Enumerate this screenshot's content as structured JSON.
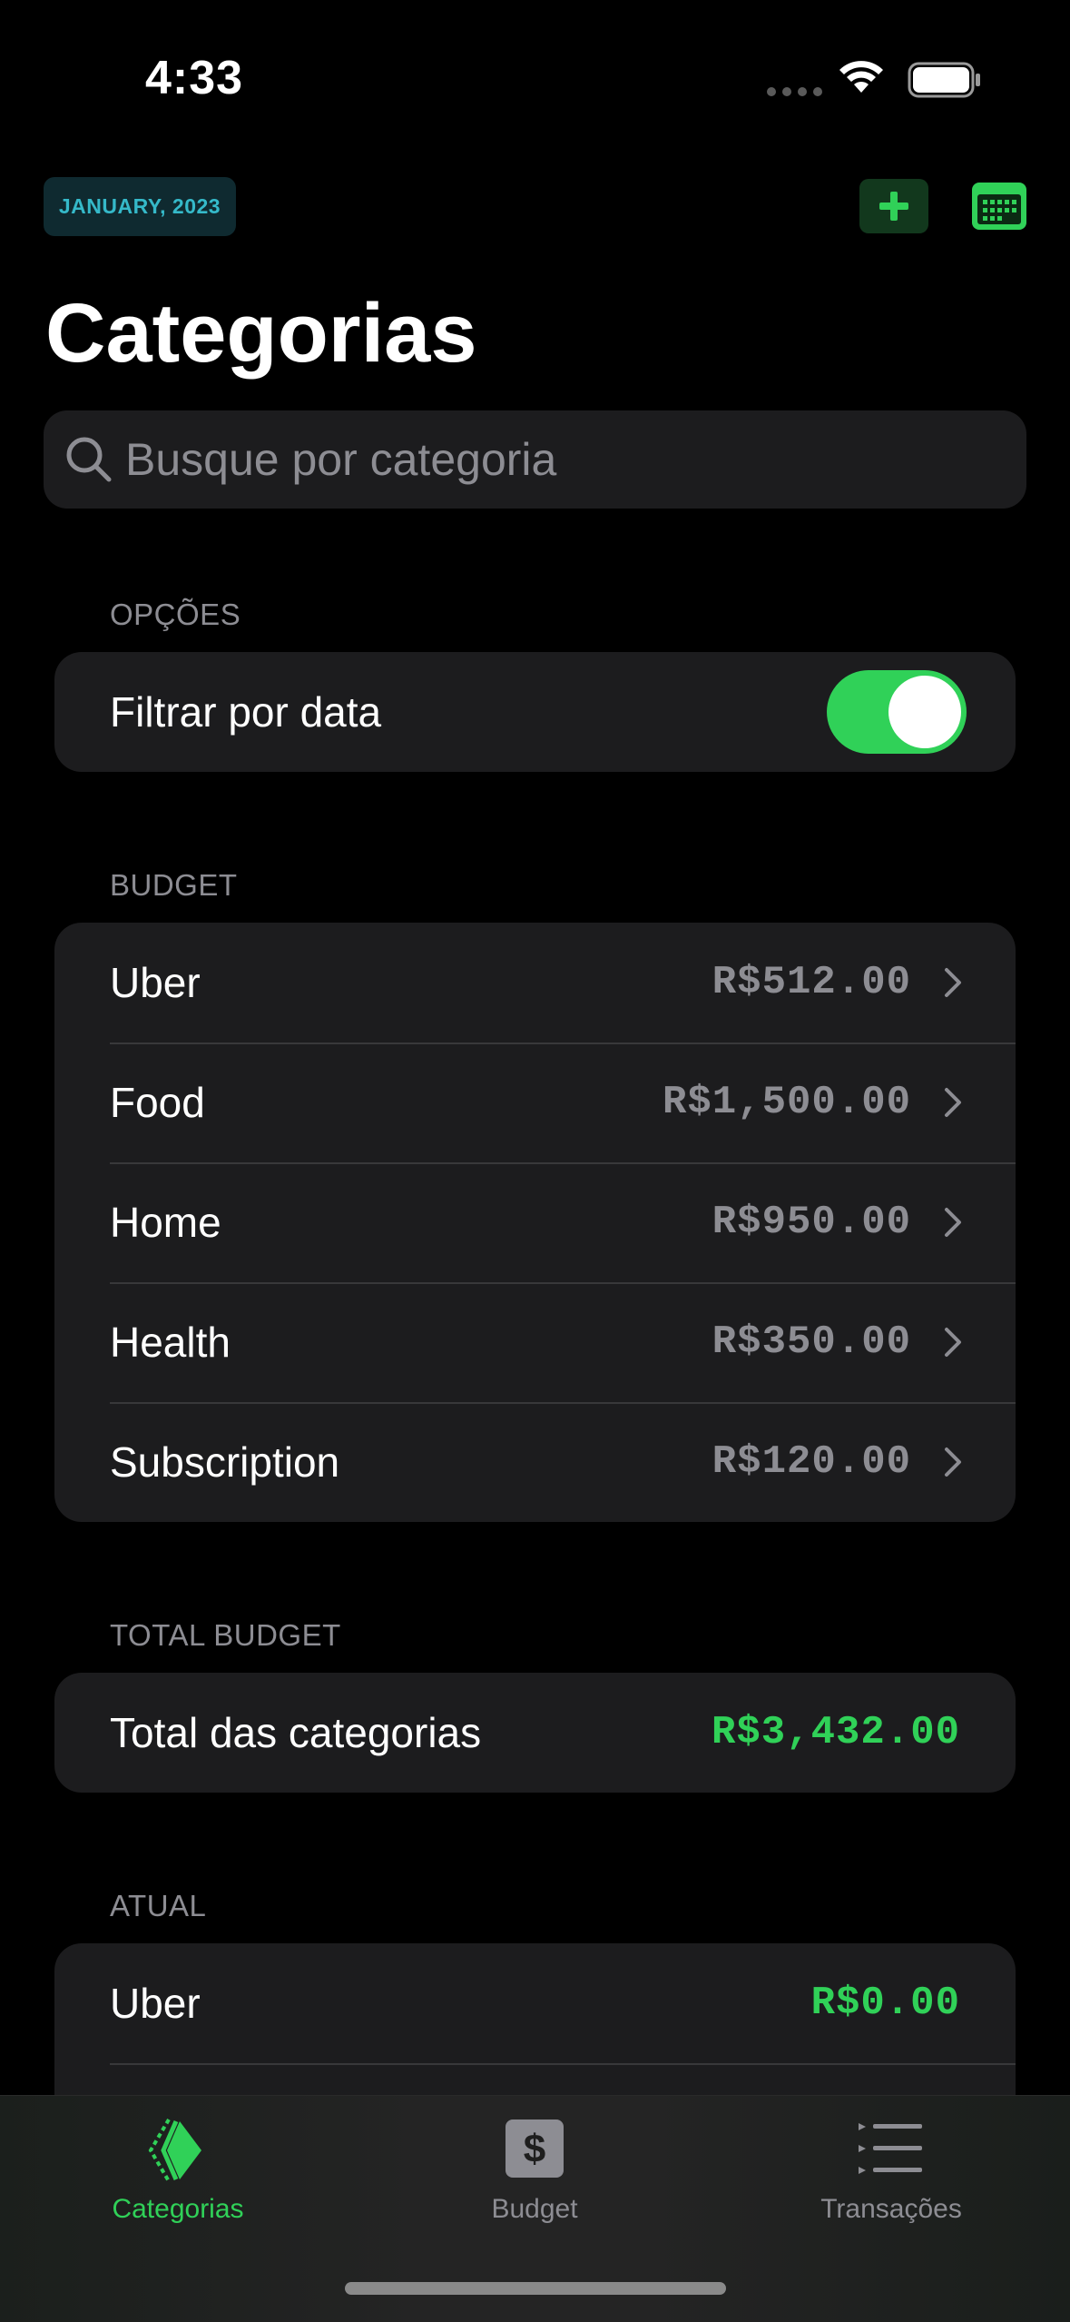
{
  "status_bar": {
    "time": "4:33"
  },
  "header": {
    "date_badge": "JANUARY, 2023",
    "title": "Categorias"
  },
  "search": {
    "placeholder": "Busque por categoria",
    "value": ""
  },
  "options": {
    "section_label": "OPÇÕES",
    "filter_label": "Filtrar por data",
    "filter_enabled": true
  },
  "budget": {
    "section_label": "BUDGET",
    "items": [
      {
        "label": "Uber",
        "value": "R$512.00"
      },
      {
        "label": "Food",
        "value": "R$1,500.00"
      },
      {
        "label": "Home",
        "value": "R$950.00"
      },
      {
        "label": "Health",
        "value": "R$350.00"
      },
      {
        "label": "Subscription",
        "value": "R$120.00"
      }
    ]
  },
  "total_budget": {
    "section_label": "TOTAL BUDGET",
    "label": "Total das categorias",
    "value": "R$3,432.00"
  },
  "atual": {
    "section_label": "ATUAL",
    "items": [
      {
        "label": "Uber",
        "value": "R$0.00"
      }
    ]
  },
  "tab_bar": {
    "tabs": [
      {
        "label": "Categorias",
        "icon": "categories-icon",
        "active": true
      },
      {
        "label": "Budget",
        "icon": "dollar-icon",
        "active": false
      },
      {
        "label": "Transações",
        "icon": "list-icon",
        "active": false
      }
    ]
  },
  "colors": {
    "accent": "#30d158",
    "badge_bg": "#0f2a30",
    "badge_text": "#35b9c9",
    "card_bg": "#1c1c1e",
    "secondary_text": "#8d8d93"
  }
}
